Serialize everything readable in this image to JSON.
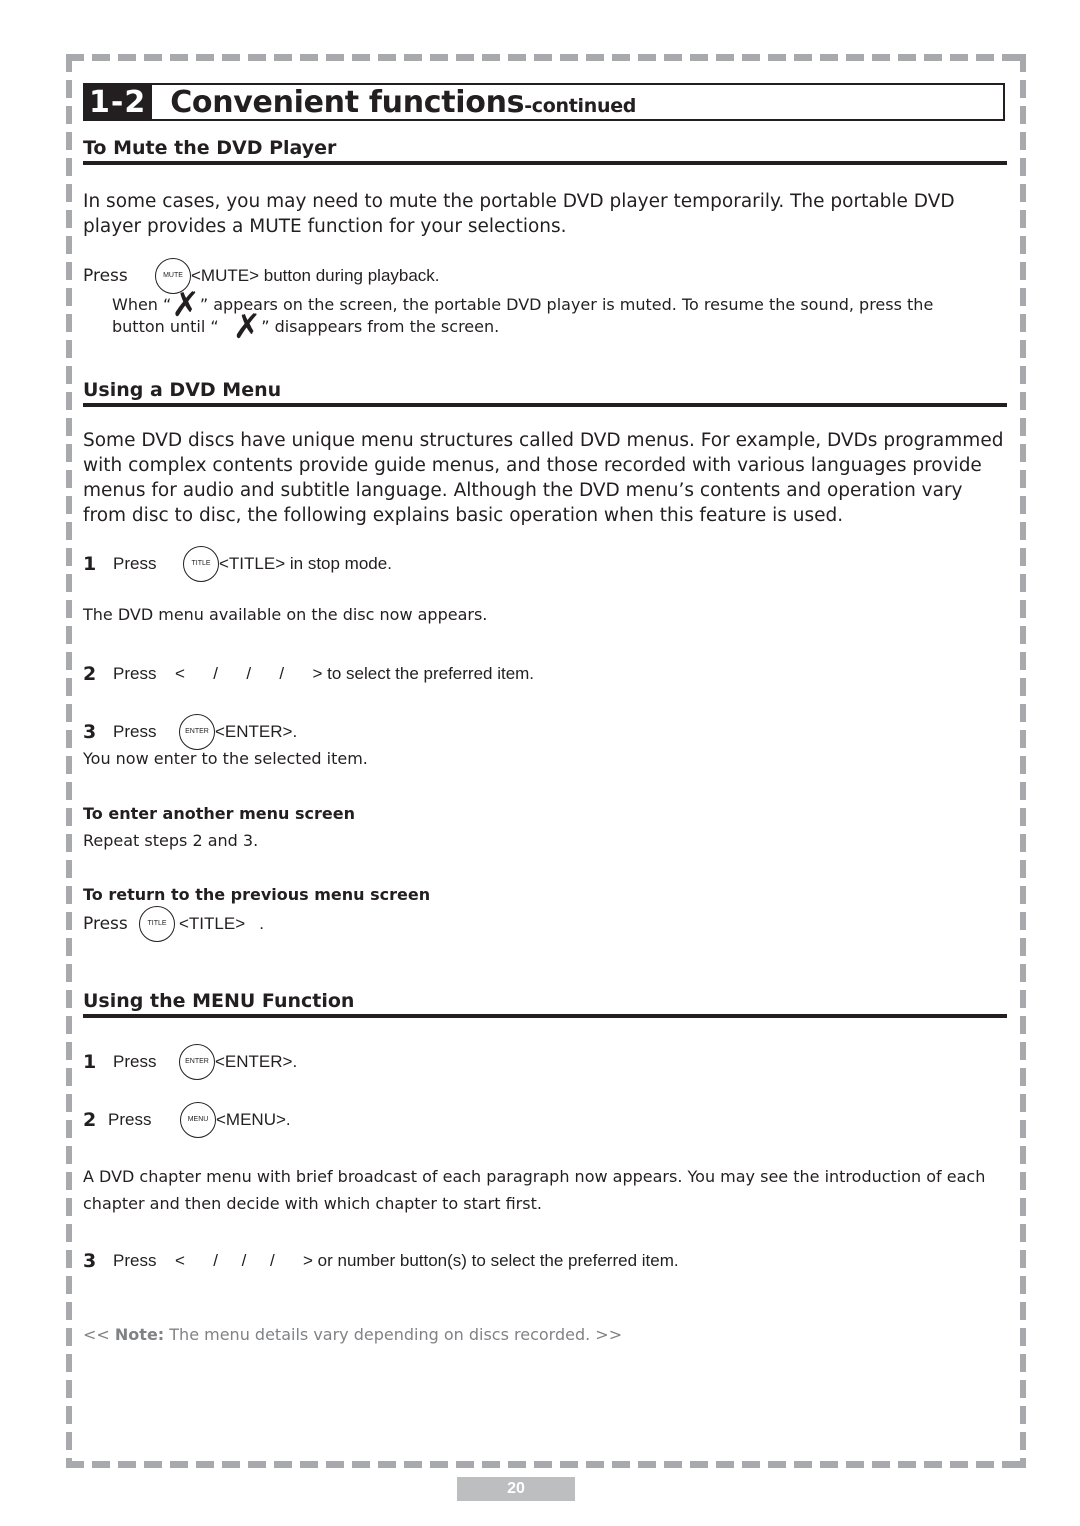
{
  "header": {
    "section_number": "1-2",
    "title": "Convenient functions",
    "subtitle": "-continued"
  },
  "mute": {
    "heading": "To Mute the DVD Player",
    "intro": "In some cases, you may need to mute the portable DVD player temporarily. The portable DVD player provides a MUTE function for your selections.",
    "press_label": "Press",
    "button_label": "MUTE",
    "press_text": "<MUTE> button during playback.",
    "line1_a": "When  “",
    "line1_b": "” appears on the screen, the portable DVD player is muted. To resume the sound, press the",
    "line2_a": "button until  “",
    "line2_b": "” disappears from the screen."
  },
  "dvd_menu": {
    "heading": "Using a DVD Menu",
    "intro": "Some DVD discs have unique menu structures called DVD menus. For example, DVDs programmed with complex contents provide guide menus, and those recorded with various languages provide menus for audio and subtitle language. Although the DVD menu’s contents and operation vary from disc to disc, the following explains basic operation when this feature is used.",
    "steps": [
      {
        "num": "1",
        "press": "Press",
        "button": "TITLE",
        "text": "<TITLE> in stop mode."
      },
      {
        "num": "2",
        "press": "Press",
        "text": "<      /      /      /      > to select the preferred item."
      },
      {
        "num": "3",
        "press": "Press",
        "button": "ENTER",
        "text": "<ENTER>."
      }
    ],
    "step1_result": "The DVD menu available on the disc now appears.",
    "step3_result": "You now enter to the selected item.",
    "another_heading": "To enter another menu screen",
    "another_text": "Repeat steps 2 and 3.",
    "return_heading": "To return to the previous menu screen",
    "return_press": "Press",
    "return_button": "TITLE",
    "return_text": "<TITLE>   ."
  },
  "menu_function": {
    "heading": "Using the MENU Function",
    "steps": [
      {
        "num": "1",
        "press": "Press",
        "button": "ENTER",
        "text": "<ENTER>."
      },
      {
        "num": "2",
        "press": "Press",
        "button": "MENU",
        "text": "<MENU>."
      },
      {
        "num": "3",
        "press": "Press",
        "text": "<      /     /     /      > or number button(s) to select the preferred item."
      }
    ],
    "description": "A DVD chapter menu with brief broadcast of each paragraph now appears. You may see the introduction of each chapter and then decide with which chapter to start first."
  },
  "note": {
    "open": "<<",
    "label": "Note:",
    "text": "The menu details vary depending on discs recorded. >>"
  },
  "page_number": "20",
  "icons": {
    "mute_symbol": "✗"
  }
}
